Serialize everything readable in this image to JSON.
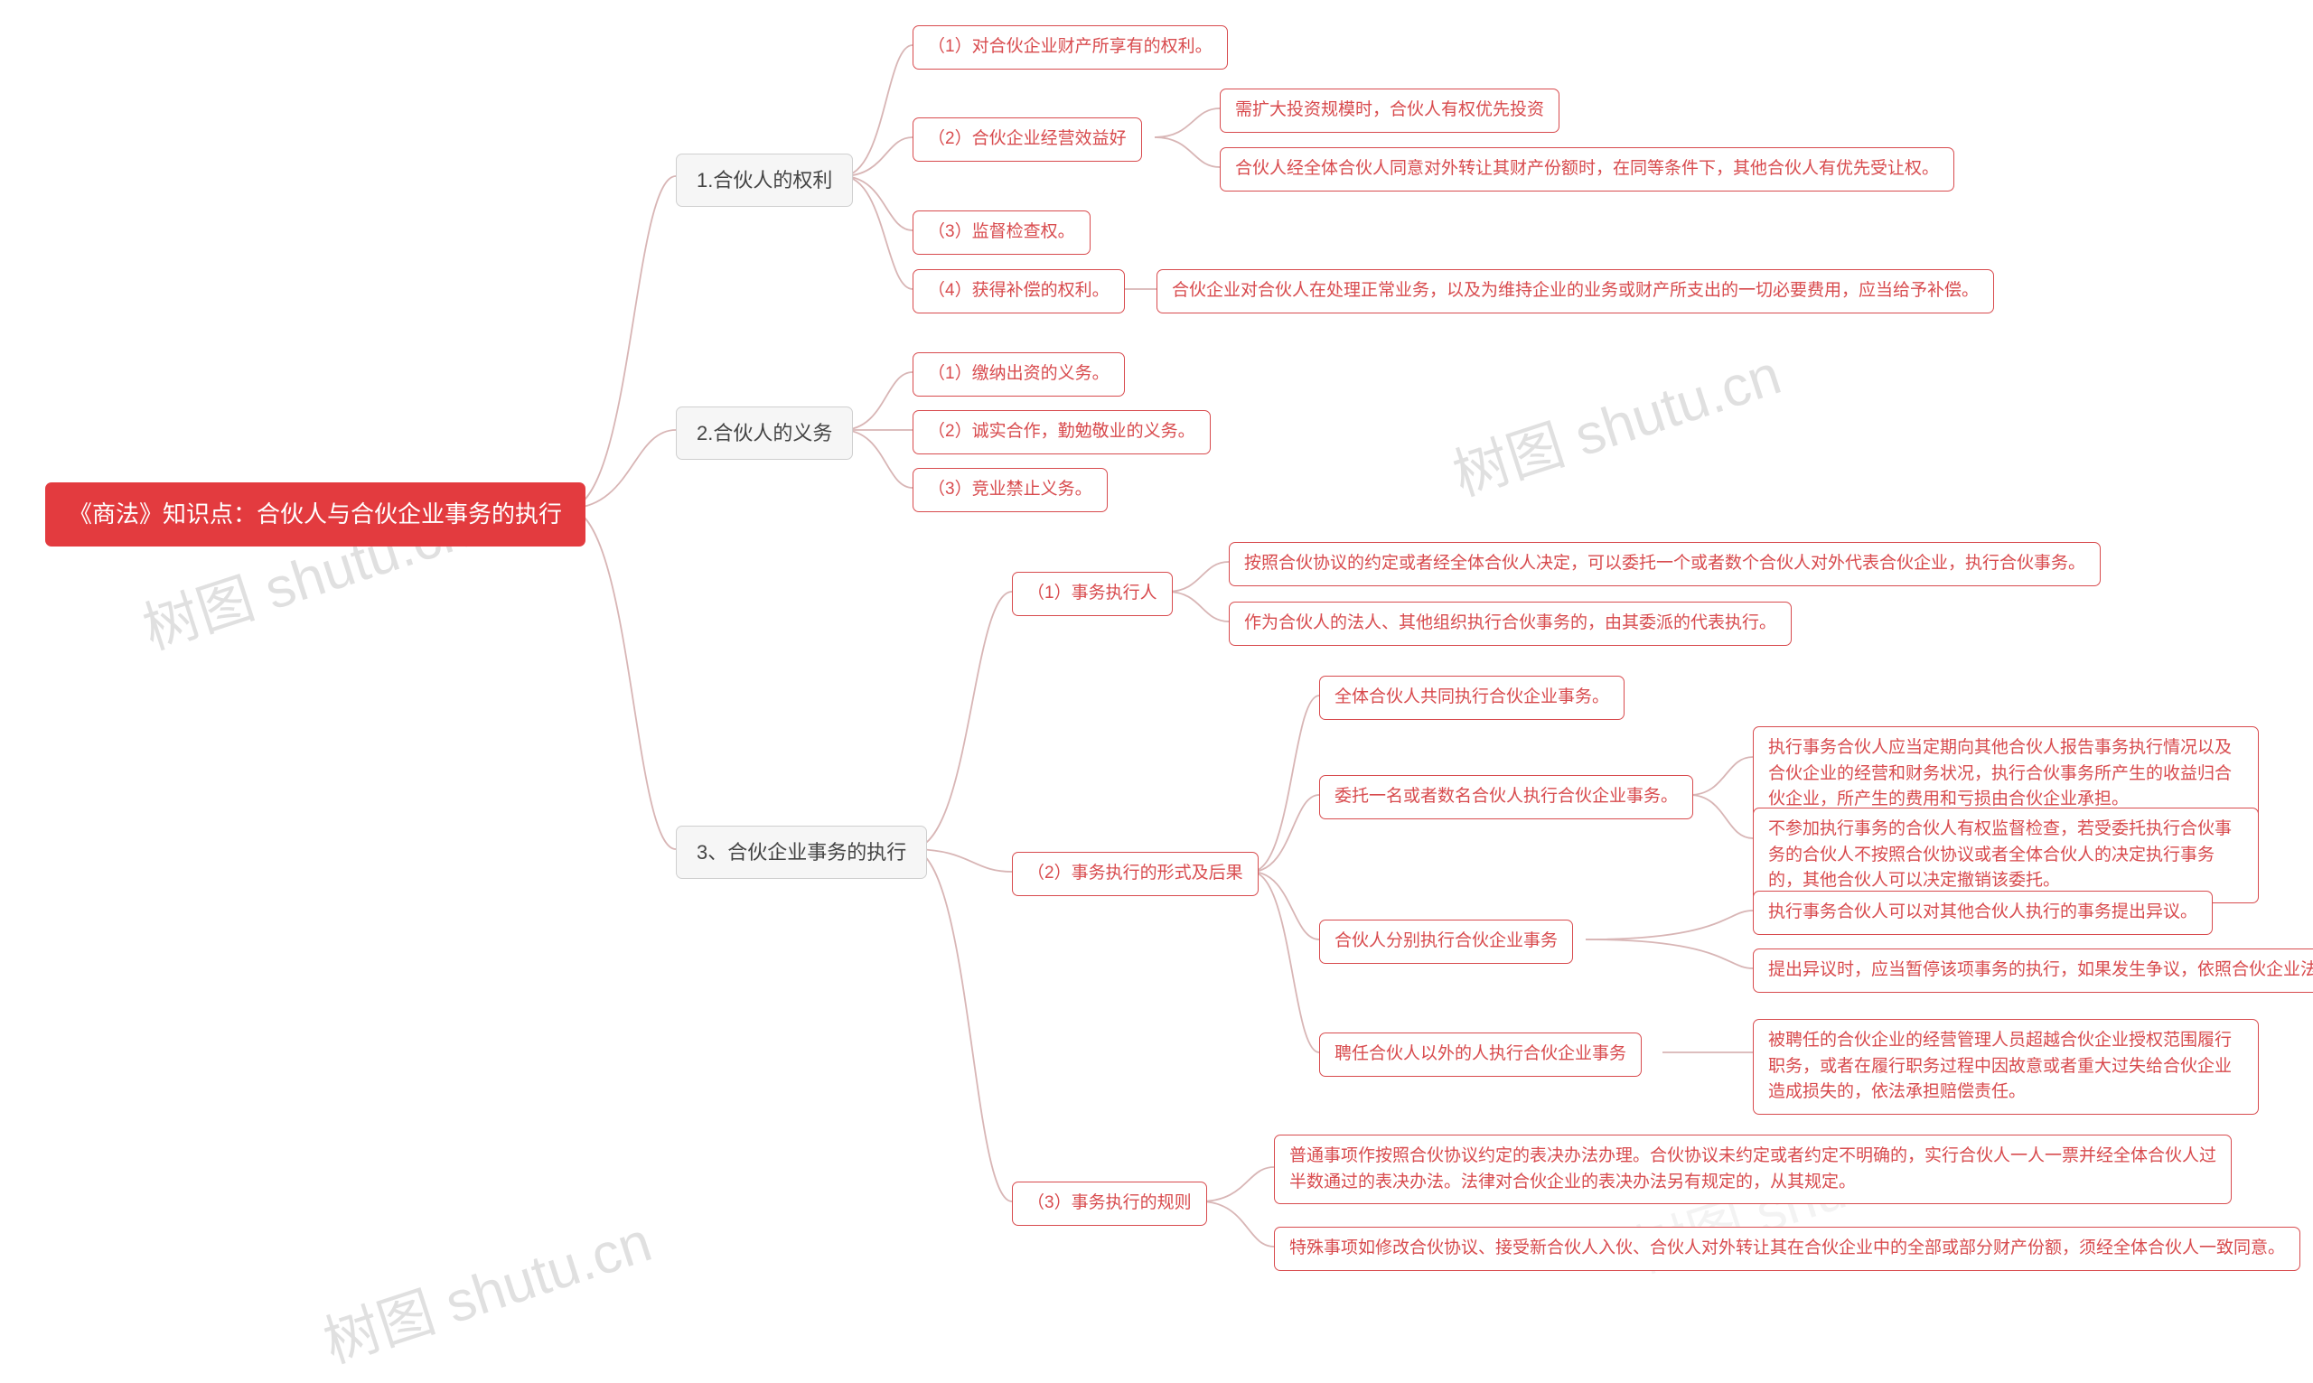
{
  "watermark": "树图 shutu.cn",
  "root": "《商法》知识点：合伙人与合伙企业事务的执行",
  "b1": {
    "title": "1.合伙人的权利",
    "c1": "（1）对合伙企业财产所享有的权利。",
    "c2": "（2）合伙企业经营效益好",
    "c2a": "需扩大投资规模时，合伙人有权优先投资",
    "c2b": "合伙人经全体合伙人同意对外转让其财产份额时，在同等条件下，其他合伙人有优先受让权。",
    "c3": "（3）监督检查权。",
    "c4": "（4）获得补偿的权利。",
    "c4a": "合伙企业对合伙人在处理正常业务，以及为维持企业的业务或财产所支出的一切必要费用，应当给予补偿。"
  },
  "b2": {
    "title": "2.合伙人的义务",
    "c1": "（1）缴纳出资的义务。",
    "c2": "（2）诚实合作，勤勉敬业的义务。",
    "c3": "（3）竞业禁止义务。"
  },
  "b3": {
    "title": "3、合伙企业事务的执行",
    "c1": "（1）事务执行人",
    "c1a": "按照合伙协议的约定或者经全体合伙人决定，可以委托一个或者数个合伙人对外代表合伙企业，执行合伙事务。",
    "c1b": "作为合伙人的法人、其他组织执行合伙事务的，由其委派的代表执行。",
    "c2": "（2）事务执行的形式及后果",
    "c2a": "全体合伙人共同执行合伙企业事务。",
    "c2b": "委托一名或者数名合伙人执行合伙企业事务。",
    "c2b1": "执行事务合伙人应当定期向其他合伙人报告事务执行情况以及合伙企业的经营和财务状况，执行合伙事务所产生的收益归合伙企业，所产生的费用和亏损由合伙企业承担。",
    "c2b2": "不参加执行事务的合伙人有权监督检查，若受委托执行合伙事务的合伙人不按照合伙协议或者全体合伙人的决定执行事务的，其他合伙人可以决定撤销该委托。",
    "c2c": "合伙人分别执行合伙企业事务",
    "c2c1": "执行事务合伙人可以对其他合伙人执行的事务提出异议。",
    "c2c2": "提出异议时，应当暂停该项事务的执行，如果发生争议，依照合伙企业法的规定作出决定。",
    "c2d": "聘任合伙人以外的人执行合伙企业事务",
    "c2d1": "被聘任的合伙企业的经营管理人员超越合伙企业授权范围履行职务，或者在履行职务过程中因故意或者重大过失给合伙企业造成损失的，依法承担赔偿责任。",
    "c3": "（3）事务执行的规则",
    "c3a": "普通事项作按照合伙协议约定的表决办法办理。合伙协议未约定或者约定不明确的，实行合伙人一人一票并经全体合伙人过半数通过的表决办法。法律对合伙企业的表决办法另有规定的，从其规定。",
    "c3b": "特殊事项如修改合伙协议、接受新合伙人入伙、合伙人对外转让其在合伙企业中的全部或部分财产份额，须经全体合伙人一致同意。"
  },
  "chart_data": {
    "type": "tree",
    "root": "《商法》知识点：合伙人与合伙企业事务的执行",
    "children": [
      {
        "label": "1.合伙人的权利",
        "children": [
          {
            "label": "（1）对合伙企业财产所享有的权利。"
          },
          {
            "label": "（2）合伙企业经营效益好",
            "children": [
              {
                "label": "需扩大投资规模时，合伙人有权优先投资"
              },
              {
                "label": "合伙人经全体合伙人同意对外转让其财产份额时，在同等条件下，其他合伙人有优先受让权。"
              }
            ]
          },
          {
            "label": "（3）监督检查权。"
          },
          {
            "label": "（4）获得补偿的权利。",
            "children": [
              {
                "label": "合伙企业对合伙人在处理正常业务，以及为维持企业的业务或财产所支出的一切必要费用，应当给予补偿。"
              }
            ]
          }
        ]
      },
      {
        "label": "2.合伙人的义务",
        "children": [
          {
            "label": "（1）缴纳出资的义务。"
          },
          {
            "label": "（2）诚实合作，勤勉敬业的义务。"
          },
          {
            "label": "（3）竞业禁止义务。"
          }
        ]
      },
      {
        "label": "3、合伙企业事务的执行",
        "children": [
          {
            "label": "（1）事务执行人",
            "children": [
              {
                "label": "按照合伙协议的约定或者经全体合伙人决定，可以委托一个或者数个合伙人对外代表合伙企业，执行合伙事务。"
              },
              {
                "label": "作为合伙人的法人、其他组织执行合伙事务的，由其委派的代表执行。"
              }
            ]
          },
          {
            "label": "（2）事务执行的形式及后果",
            "children": [
              {
                "label": "全体合伙人共同执行合伙企业事务。"
              },
              {
                "label": "委托一名或者数名合伙人执行合伙企业事务。",
                "children": [
                  {
                    "label": "执行事务合伙人应当定期向其他合伙人报告事务执行情况以及合伙企业的经营和财务状况，执行合伙事务所产生的收益归合伙企业，所产生的费用和亏损由合伙企业承担。"
                  },
                  {
                    "label": "不参加执行事务的合伙人有权监督检查，若受委托执行合伙事务的合伙人不按照合伙协议或者全体合伙人的决定执行事务的，其他合伙人可以决定撤销该委托。"
                  }
                ]
              },
              {
                "label": "合伙人分别执行合伙企业事务",
                "children": [
                  {
                    "label": "执行事务合伙人可以对其他合伙人执行的事务提出异议。"
                  },
                  {
                    "label": "提出异议时，应当暂停该项事务的执行，如果发生争议，依照合伙企业法的规定作出决定。"
                  }
                ]
              },
              {
                "label": "聘任合伙人以外的人执行合伙企业事务",
                "children": [
                  {
                    "label": "被聘任的合伙企业的经营管理人员超越合伙企业授权范围履行职务，或者在履行职务过程中因故意或者重大过失给合伙企业造成损失的，依法承担赔偿责任。"
                  }
                ]
              }
            ]
          },
          {
            "label": "（3）事务执行的规则",
            "children": [
              {
                "label": "普通事项作按照合伙协议约定的表决办法办理。合伙协议未约定或者约定不明确的，实行合伙人一人一票并经全体合伙人过半数通过的表决办法。法律对合伙企业的表决办法另有规定的，从其规定。"
              },
              {
                "label": "特殊事项如修改合伙协议、接受新合伙人入伙、合伙人对外转让其在合伙企业中的全部或部分财产份额，须经全体合伙人一致同意。"
              }
            ]
          }
        ]
      }
    ]
  }
}
